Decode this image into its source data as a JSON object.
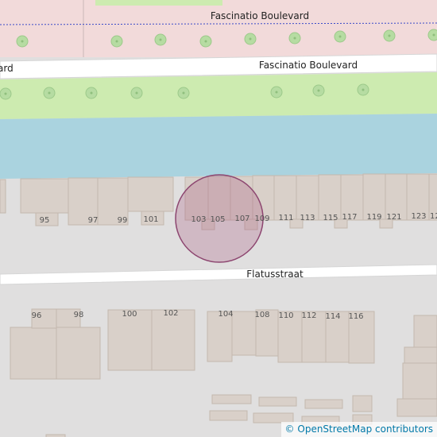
{
  "streets": {
    "north_upper": "Fascinatio Boulevard",
    "north_main": "Fascinatio Boulevard",
    "north_main_left_fragment": "ard",
    "south": "Flatusstraat"
  },
  "house_numbers_north": [
    "95",
    "97",
    "99",
    "101",
    "103",
    "105",
    "107",
    "109",
    "111",
    "113",
    "115",
    "117",
    "119",
    "121",
    "123",
    "12"
  ],
  "house_numbers_south": [
    "96",
    "98",
    "100",
    "102",
    "104",
    "108",
    "110",
    "112",
    "114",
    "116"
  ],
  "attribution": {
    "symbol": "©",
    "text": "OpenStreetMap contributors"
  },
  "colors": {
    "background": "#e0dfdf",
    "residential": "#f2dada",
    "grass": "#cdebb0",
    "water": "#aad3df",
    "building": "#d9d0c9",
    "road": "#ffffff",
    "tree": "#b0d8a0",
    "marker": "#a8557f"
  }
}
